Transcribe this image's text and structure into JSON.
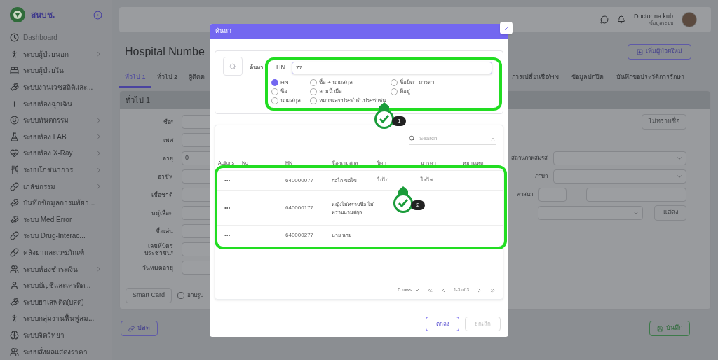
{
  "sidebar": {
    "logo_text": "สนบช.",
    "items": [
      {
        "label": "Dashboard",
        "has_submenu": false
      },
      {
        "label": "ระบบผู้ป่วยนอก",
        "has_submenu": true
      },
      {
        "label": "ระบบผู้ป่วยใน",
        "has_submenu": false
      },
      {
        "label": "ระบบงานเวชสถิติและ...",
        "has_submenu": false
      },
      {
        "label": "ระบบห้องฉุกเฉิน",
        "has_submenu": false
      },
      {
        "label": "ระบบทันตกรรม",
        "has_submenu": true
      },
      {
        "label": "ระบบห้อง LAB",
        "has_submenu": true
      },
      {
        "label": "ระบบห้อง X-Ray",
        "has_submenu": true
      },
      {
        "label": "ระบบโภชนาการ",
        "has_submenu": true
      },
      {
        "label": "เภสัชกรรม",
        "has_submenu": true
      },
      {
        "label": "บันทึกข้อมูลการแพ้ยา...",
        "has_submenu": false
      },
      {
        "label": "ระบบ Med Error",
        "has_submenu": false
      },
      {
        "label": "ระบบ Drug-Interac...",
        "has_submenu": false
      },
      {
        "label": "คลังยาและเวชภัณฑ์",
        "has_submenu": false
      },
      {
        "label": "ระบบห้องชำระเงิน",
        "has_submenu": true
      },
      {
        "label": "ระบบบัญชีและเครดิต...",
        "has_submenu": false
      },
      {
        "label": "ระบบยาเสพติด(บสต)",
        "has_submenu": false
      },
      {
        "label": "ระบบกลุ่มงานฟื้นฟูสม...",
        "has_submenu": false
      },
      {
        "label": "ระบบจิตวิทยา",
        "has_submenu": false
      },
      {
        "label": "ระบบสั่งผลแสดงราคา",
        "has_submenu": false
      }
    ]
  },
  "header": {
    "user_name": "Doctor na kub",
    "user_role": "ข้อมูลระบบ"
  },
  "page": {
    "title": "Hospital Numbe",
    "add_button": "เพิ่มผู้ป่วยใหม่",
    "tabs_left": [
      {
        "label": "ทั่วไป 1",
        "selected": true
      },
      {
        "label": "ทั่วไป 2",
        "selected": false
      },
      {
        "label": "ผู้ติดต",
        "selected": false
      }
    ],
    "tabs_right": [
      {
        "label": "การเปลี่ยนชื่อ/HN",
        "selected": false
      },
      {
        "label": "ข้อมูลปกปิด",
        "selected": false
      },
      {
        "label": "บันทึกขอประวัติการรักษา",
        "selected": false
      }
    ],
    "card_title": "ทั่วไป 1",
    "form_rows": [
      {
        "label": "ชื่อ*",
        "right": {
          "kind": "button",
          "label": "ไม่ทราบชื่อ"
        }
      },
      {
        "label": "เพศ"
      },
      {
        "label": "อายุ",
        "placeholder": "0",
        "right": {
          "kind": "select",
          "label": "สถานภาพสมรส"
        }
      },
      {
        "label": "อาชีพ",
        "right": {
          "kind": "select",
          "label": "ภาษา"
        }
      },
      {
        "label": "เชื้อชาติ",
        "right": {
          "kind": "pair",
          "label": "ศาสนา"
        }
      },
      {
        "label": "หมู่เลือด",
        "right": {
          "kind": "select-button",
          "label": "แสดง"
        }
      },
      {
        "label": "ชื่อเล่น"
      },
      {
        "label": "เลขที่บัตรประชาชน*"
      },
      {
        "label": "วันหมดอายุ"
      }
    ],
    "smart_card_button": "Smart Card",
    "read_photo": {
      "label": "อ่านรูป",
      "checked": false
    },
    "left_footer_button": "ปลด",
    "save_button": "บันทึก"
  },
  "dialog": {
    "title": "ค้นหา",
    "search_label": "ค้นหา",
    "field_label": "HN",
    "field_value": "77",
    "options": [
      {
        "label": "HN",
        "selected": true
      },
      {
        "label": "ชื่อ + นามสกุล",
        "selected": false
      },
      {
        "label": "ชื่อบิดา-มารดา",
        "selected": false
      },
      {
        "label": "ชื่อ",
        "selected": false
      },
      {
        "label": "ลายนิ้วมือ",
        "selected": false
      },
      {
        "label": "ที่อยู่",
        "selected": false
      },
      {
        "label": "นามสกุล",
        "selected": false
      },
      {
        "label": "หมายเลขประจำตัวประชาชน",
        "selected": false
      }
    ],
    "table": {
      "search_placeholder": "Search",
      "columns": [
        "Actions",
        "No",
        "HN",
        "ชื่อ-นามสกุล",
        "บิดา",
        "มารดา",
        "หมายเหตุ"
      ],
      "rows": [
        {
          "hn": "640000077",
          "name": "กอไก่ ขอไข่",
          "father": "ไก่ไก่",
          "mother": "ไข่ไข่"
        },
        {
          "hn": "640000177",
          "name": "หญิงไม่ทราบชื่อ ไม่ทราบนามสกุล"
        },
        {
          "hn": "640000277",
          "name": "นาย นาย"
        }
      ],
      "rows_per_page": "5 rows",
      "range": "1-3 of 3"
    },
    "ok_button": "ตกลง",
    "cancel_button": {
      "label": "ยกเลิก",
      "disabled": true
    }
  },
  "annotations": [
    {
      "number": "1"
    },
    {
      "number": "2"
    }
  ]
}
